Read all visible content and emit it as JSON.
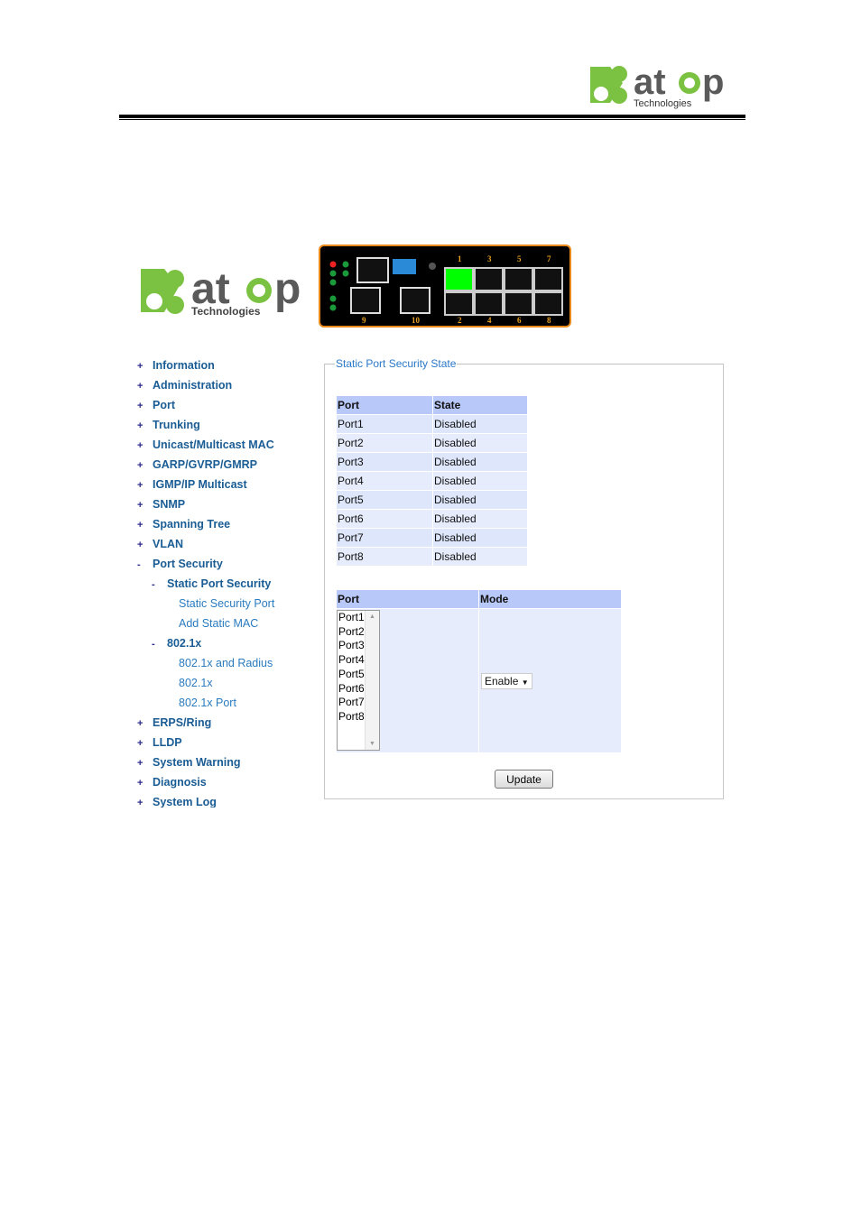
{
  "header": {
    "logo_text": "atop",
    "logo_sub": "Technologies"
  },
  "device": {
    "port_labels_top": [
      "1",
      "3",
      "5",
      "7"
    ],
    "port_labels_bottom": [
      "2",
      "4",
      "6",
      "8"
    ],
    "uplink_labels": [
      "9",
      "10"
    ],
    "active_port": "1",
    "active_color": "#00ff00",
    "frame_color": "#e8891c"
  },
  "sidebar": {
    "items": [
      {
        "sym": "+",
        "label": "Information",
        "level": 1
      },
      {
        "sym": "+",
        "label": "Administration",
        "level": 1
      },
      {
        "sym": "+",
        "label": "Port",
        "level": 1
      },
      {
        "sym": "+",
        "label": "Trunking",
        "level": 1
      },
      {
        "sym": "+",
        "label": "Unicast/Multicast MAC",
        "level": 1
      },
      {
        "sym": "+",
        "label": "GARP/GVRP/GMRP",
        "level": 1
      },
      {
        "sym": "+",
        "label": "IGMP/IP Multicast",
        "level": 1
      },
      {
        "sym": "+",
        "label": "SNMP",
        "level": 1
      },
      {
        "sym": "+",
        "label": "Spanning Tree",
        "level": 1
      },
      {
        "sym": "+",
        "label": "VLAN",
        "level": 1
      },
      {
        "sym": "-",
        "label": "Port Security",
        "level": 1
      },
      {
        "sym": "-",
        "label": "Static Port Security",
        "level": 2
      },
      {
        "sym": "",
        "label": "Static Security Port",
        "level": 3
      },
      {
        "sym": "",
        "label": "Add Static MAC",
        "level": 3
      },
      {
        "sym": "-",
        "label": "802.1x",
        "level": 2
      },
      {
        "sym": "",
        "label": "802.1x and Radius",
        "level": 3
      },
      {
        "sym": "",
        "label": "802.1x",
        "level": 3
      },
      {
        "sym": "",
        "label": "802.1x Port",
        "level": 3
      },
      {
        "sym": "+",
        "label": "ERPS/Ring",
        "level": 1
      },
      {
        "sym": "+",
        "label": "LLDP",
        "level": 1
      },
      {
        "sym": "+",
        "label": "System Warning",
        "level": 1
      },
      {
        "sym": "+",
        "label": "Diagnosis",
        "level": 1
      },
      {
        "sym": "+",
        "label": "System Log",
        "level": 1
      }
    ]
  },
  "main": {
    "legend": "Static Port Security State",
    "state_table": {
      "headers": [
        "Port",
        "State"
      ],
      "rows": [
        [
          "Port1",
          "Disabled"
        ],
        [
          "Port2",
          "Disabled"
        ],
        [
          "Port3",
          "Disabled"
        ],
        [
          "Port4",
          "Disabled"
        ],
        [
          "Port5",
          "Disabled"
        ],
        [
          "Port6",
          "Disabled"
        ],
        [
          "Port7",
          "Disabled"
        ],
        [
          "Port8",
          "Disabled"
        ]
      ]
    },
    "config_table": {
      "headers": [
        "Port",
        "Mode"
      ],
      "ports": [
        "Port1",
        "Port2",
        "Port3",
        "Port4",
        "Port5",
        "Port6",
        "Port7",
        "Port8"
      ],
      "mode_value": "Enable"
    },
    "update_label": "Update"
  }
}
